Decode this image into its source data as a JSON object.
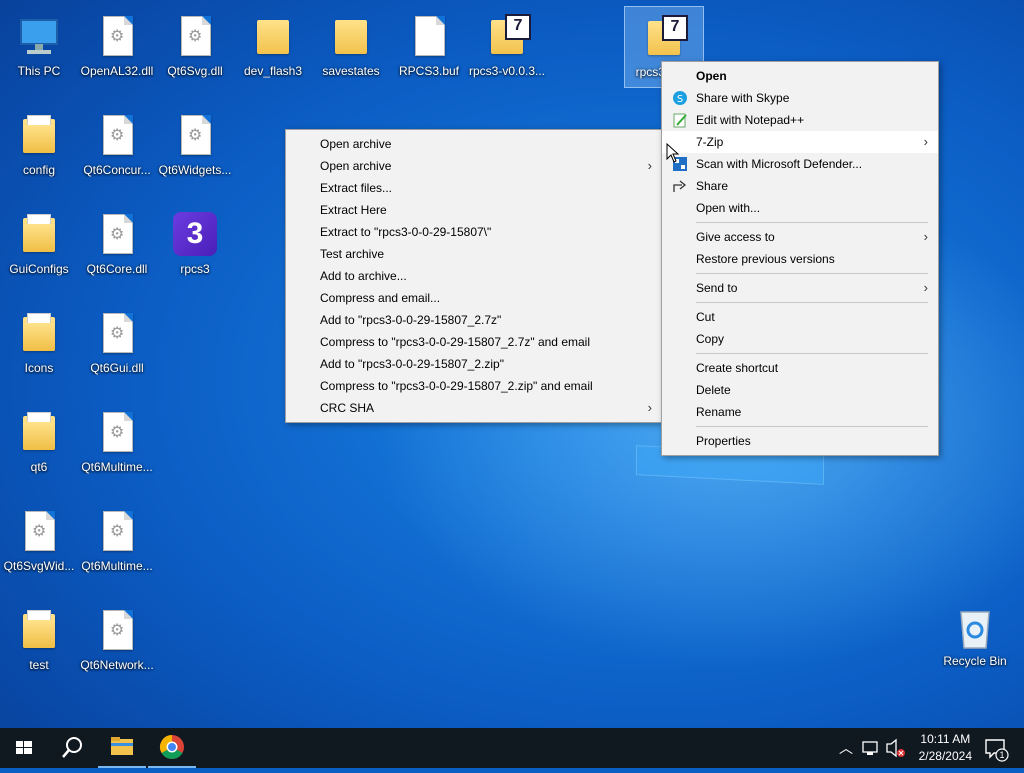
{
  "desktop": {
    "icons": [
      {
        "label": "This PC"
      },
      {
        "label": "OpenAL32.dll"
      },
      {
        "label": "Qt6Svg.dll"
      },
      {
        "label": "dev_flash3"
      },
      {
        "label": "savestates"
      },
      {
        "label": "RPCS3.buf"
      },
      {
        "label": "rpcs3-v0.0.3..."
      },
      {
        "label": "rpcs3-...15"
      },
      {
        "label": "config"
      },
      {
        "label": "Qt6Concur..."
      },
      {
        "label": "Qt6Widgets..."
      },
      {
        "label": "GuiConfigs"
      },
      {
        "label": "Qt6Core.dll"
      },
      {
        "label": "rpcs3"
      },
      {
        "label": "Icons"
      },
      {
        "label": "Qt6Gui.dll"
      },
      {
        "label": "qt6"
      },
      {
        "label": "Qt6Multime..."
      },
      {
        "label": "Qt6SvgWid..."
      },
      {
        "label": "Qt6Multime..."
      },
      {
        "label": "test"
      },
      {
        "label": "Qt6Network..."
      },
      {
        "label": "Recycle Bin"
      }
    ],
    "rpcs3_logo_glyph": "3",
    "zip_badge": "7"
  },
  "context_menu": {
    "items": [
      {
        "label": "Open"
      },
      {
        "label": "Share with Skype"
      },
      {
        "label": "Edit with Notepad++"
      },
      {
        "label": "7-Zip"
      },
      {
        "label": "Scan with Microsoft Defender..."
      },
      {
        "label": "Share"
      },
      {
        "label": "Open with..."
      },
      {
        "label": "Give access to"
      },
      {
        "label": "Restore previous versions"
      },
      {
        "label": "Send to"
      },
      {
        "label": "Cut"
      },
      {
        "label": "Copy"
      },
      {
        "label": "Create shortcut"
      },
      {
        "label": "Delete"
      },
      {
        "label": "Rename"
      },
      {
        "label": "Properties"
      }
    ]
  },
  "zip_menu": {
    "items": [
      {
        "label": "Open archive"
      },
      {
        "label": "Open archive"
      },
      {
        "label": "Extract files..."
      },
      {
        "label": "Extract Here"
      },
      {
        "label": "Extract to \"rpcs3-0-0-29-15807\\\""
      },
      {
        "label": "Test archive"
      },
      {
        "label": "Add to archive..."
      },
      {
        "label": "Compress and email..."
      },
      {
        "label": "Add to \"rpcs3-0-0-29-15807_2.7z\""
      },
      {
        "label": "Compress to \"rpcs3-0-0-29-15807_2.7z\" and email"
      },
      {
        "label": "Add to \"rpcs3-0-0-29-15807_2.zip\""
      },
      {
        "label": "Compress to \"rpcs3-0-0-29-15807_2.zip\" and email"
      },
      {
        "label": "CRC SHA"
      }
    ]
  },
  "taskbar": {
    "time": "10:11 AM",
    "date": "2/28/2024",
    "notification_count": "1"
  },
  "colors": {
    "taskbar": "#101820",
    "desktop": "#0b5bc2",
    "menu_bg": "#f2f2f2"
  }
}
